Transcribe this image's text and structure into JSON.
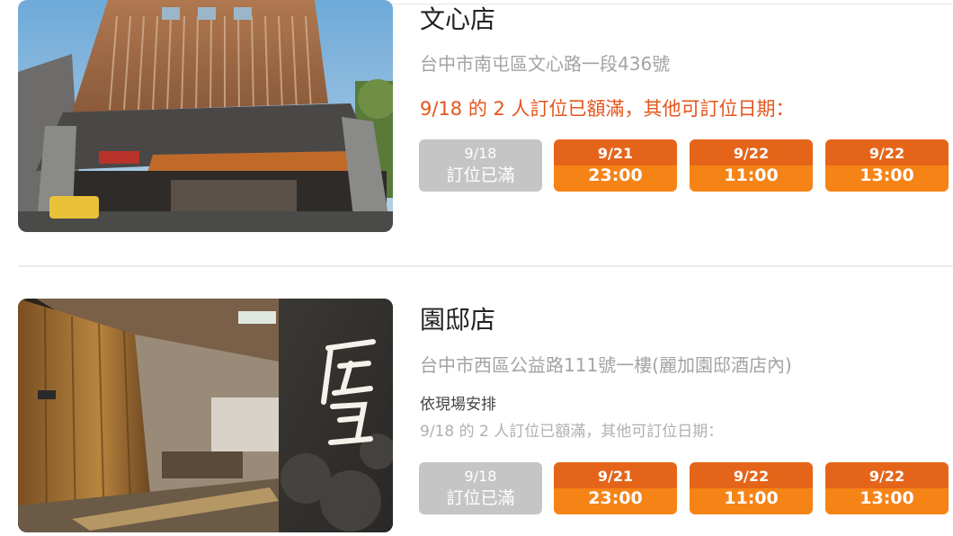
{
  "restaurants": [
    {
      "name": "文心店",
      "address": "台中市南屯區文心路一段436號",
      "note": "",
      "full_message": "9/18 的 2 人訂位已額滿，其他可訂位日期：",
      "slots": [
        {
          "date": "9/18",
          "time": "訂位已滿",
          "status": "full"
        },
        {
          "date": "9/21",
          "time": "23:00",
          "status": "open"
        },
        {
          "date": "9/22",
          "time": "11:00",
          "status": "open"
        },
        {
          "date": "9/22",
          "time": "13:00",
          "status": "open"
        }
      ]
    },
    {
      "name": "園邸店",
      "address": "台中市西區公益路111號一樓(麗加園邸酒店內)",
      "note": "依現場安排",
      "full_message": "9/18 的 2 人訂位已額滿，其他可訂位日期：",
      "slots": [
        {
          "date": "9/18",
          "time": "訂位已滿",
          "status": "full"
        },
        {
          "date": "9/21",
          "time": "23:00",
          "status": "open"
        },
        {
          "date": "9/22",
          "time": "11:00",
          "status": "open"
        },
        {
          "date": "9/22",
          "time": "13:00",
          "status": "open"
        }
      ]
    }
  ],
  "colors": {
    "accent": "#e4551c",
    "slot_open_top": "#e4651a",
    "slot_open_bottom": "#f68316",
    "slot_full": "#c5c5c5",
    "muted_text": "#a3a3a3"
  }
}
